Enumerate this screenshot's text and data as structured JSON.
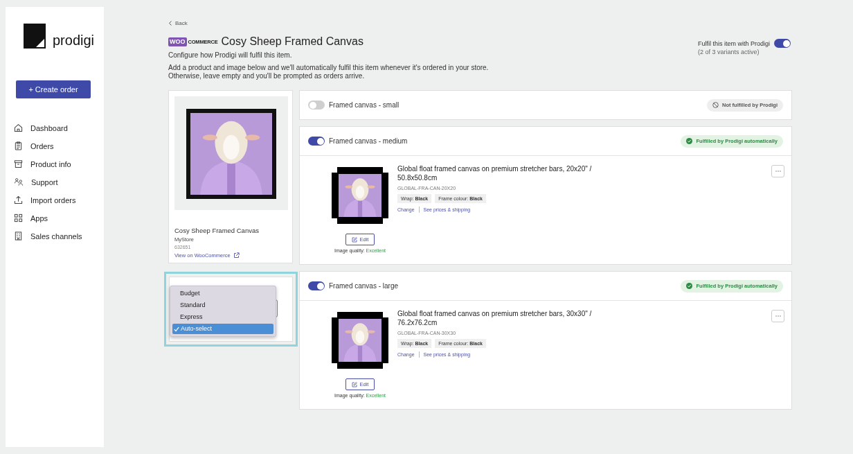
{
  "sidebar": {
    "logo": "prodigi",
    "create_button": "+ Create order",
    "nav": [
      {
        "label": "Dashboard"
      },
      {
        "label": "Orders"
      },
      {
        "label": "Product info"
      },
      {
        "label": "Support"
      },
      {
        "label": "Import orders"
      },
      {
        "label": "Apps"
      },
      {
        "label": "Sales channels"
      }
    ]
  },
  "header": {
    "back": "Back",
    "logo": {
      "part_1": "WOO",
      "part_2": "COMMERCE"
    },
    "title": "Cosy Sheep Framed Canvas",
    "intro": "Configure how Prodigi will fulfil this item.",
    "description": [
      "Add a product and image below and we'll automatically fulfil this item whenever it's ordered in your store.",
      "Otherwise, leave empty and you'll be prompted as orders arrive."
    ],
    "fulfil": {
      "label": "Fulfil this item with Prodigi",
      "sub": "(2 of 3 variants active)",
      "on": true
    }
  },
  "product": {
    "name": "Cosy Sheep Framed Canvas",
    "store": "MyStore",
    "id": "632651",
    "link": "View on WooCommerce"
  },
  "shipping": {
    "options": [
      {
        "label": "Budget",
        "selected": false
      },
      {
        "label": "Standard",
        "selected": false
      },
      {
        "label": "Express",
        "selected": false
      },
      {
        "label": "Auto-select",
        "selected": true
      }
    ]
  },
  "variants": [
    {
      "name": "Framed canvas - small",
      "on": false,
      "status": {
        "kind": "not",
        "text": "Not fulfilled by Prodigi"
      }
    },
    {
      "name": "Framed canvas - medium",
      "on": true,
      "status": {
        "kind": "auto",
        "text": "Fulfilled by Prodigi automatically"
      },
      "product": {
        "title": "Global float framed canvas on premium stretcher bars, 20x20\" / 50.8x50.8cm",
        "sku": "GLOBAL-FRA-CAN-20X20",
        "tags": [
          "Wrap: **Black**",
          "Frame colour: **Black**"
        ],
        "links": [
          "Change",
          "See prices & shipping"
        ],
        "edit": "Edit",
        "quality_label": "Image quality:",
        "quality": "Excellent"
      }
    },
    {
      "name": "Framed canvas - large",
      "on": true,
      "status": {
        "kind": "auto",
        "text": "Fulfilled by Prodigi automatically"
      },
      "product": {
        "title": "Global float framed canvas on premium stretcher bars, 30x30\" / 76.2x76.2cm",
        "sku": "GLOBAL-FRA-CAN-30X30",
        "tags": [
          "Wrap: **Black**",
          "Frame colour: **Black**"
        ],
        "links": [
          "Change",
          "See prices & shipping"
        ],
        "edit": "Edit",
        "quality_label": "Image quality:",
        "quality": "Excellent"
      }
    }
  ]
}
